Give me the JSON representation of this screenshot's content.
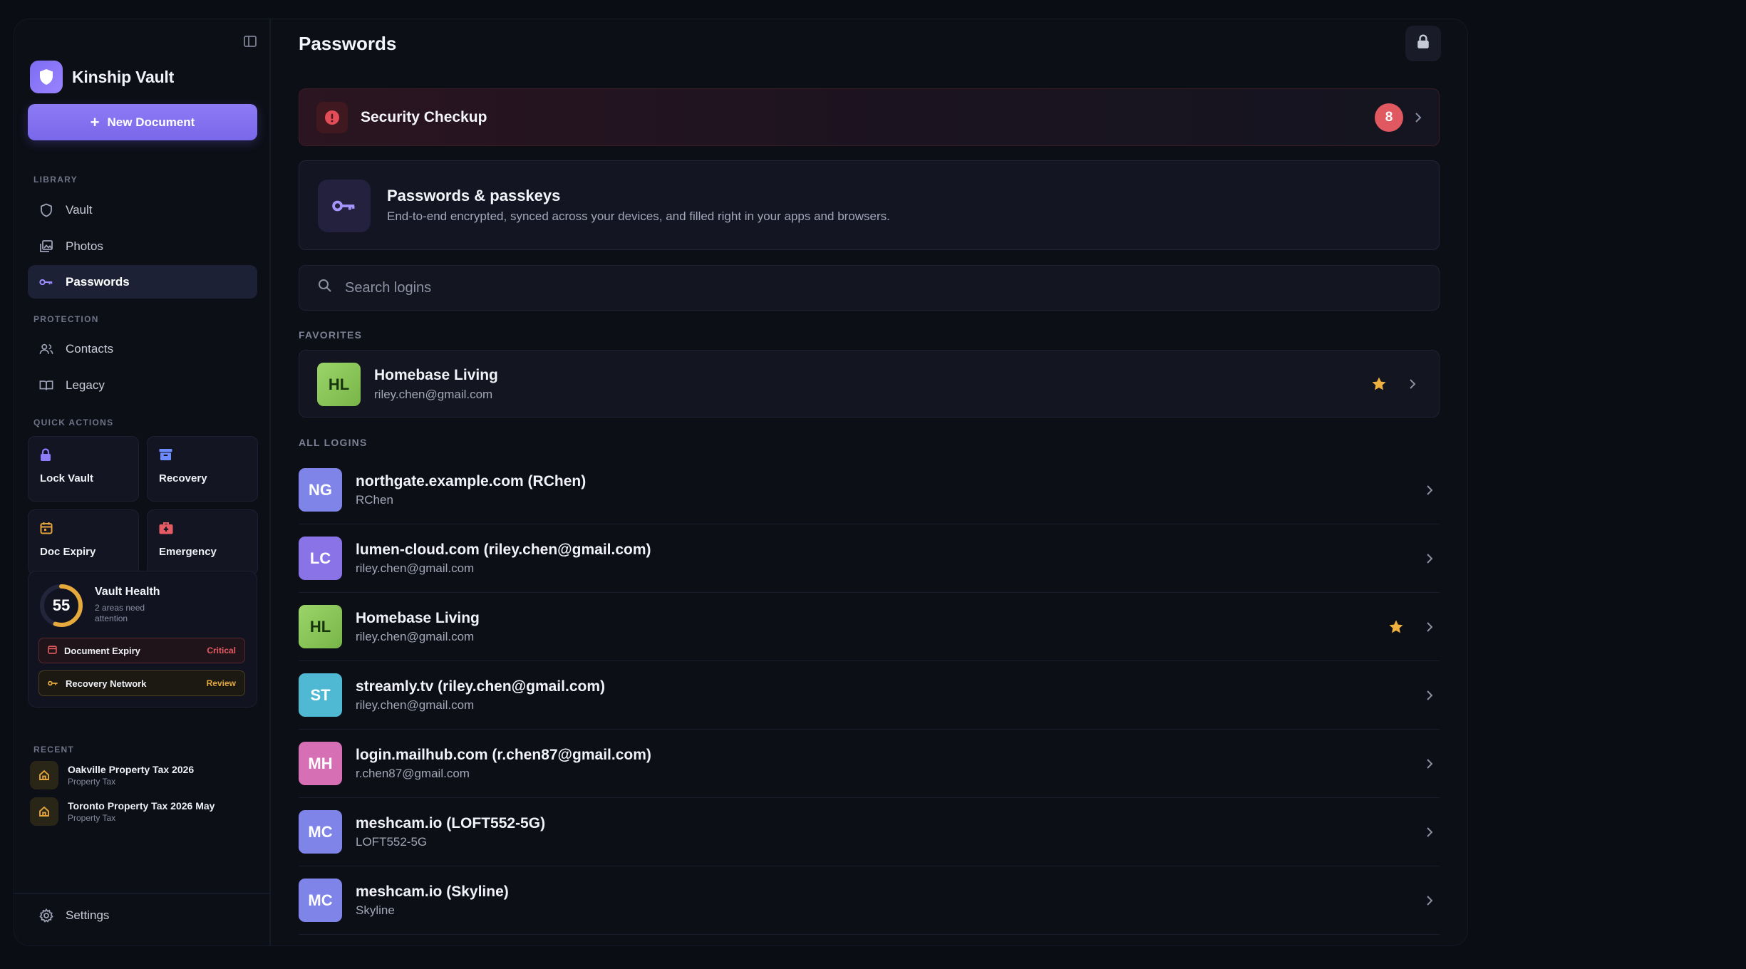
{
  "app": {
    "name": "Kinship Vault"
  },
  "sidebar": {
    "new_document_label": "New Document",
    "library_label": "LIBRARY",
    "library_items": [
      {
        "label": "Vault",
        "icon": "shield-icon"
      },
      {
        "label": "Photos",
        "icon": "photos-icon"
      },
      {
        "label": "Passwords",
        "icon": "key-icon",
        "active": true
      }
    ],
    "protection_label": "PROTECTION",
    "protection_items": [
      {
        "label": "Contacts",
        "icon": "contacts-icon"
      },
      {
        "label": "Legacy",
        "icon": "book-icon"
      }
    ],
    "quick_actions_label": "QUICK ACTIONS",
    "quick_actions": [
      {
        "label": "Lock Vault",
        "icon": "lock-icon",
        "color": "#8f7dff"
      },
      {
        "label": "Recovery",
        "icon": "archive-icon",
        "color": "#6f8cff"
      },
      {
        "label": "Doc Expiry",
        "icon": "calendar-icon",
        "color": "#e3a43c"
      },
      {
        "label": "Emergency",
        "icon": "medkit-icon",
        "color": "#e45b63"
      }
    ],
    "vault_health": {
      "score": "55",
      "score_value": 55,
      "title": "Vault Health",
      "subtitle": "2 areas need attention",
      "items": [
        {
          "label": "Document Expiry",
          "status": "Critical",
          "status_color": "#e65a62"
        },
        {
          "label": "Recovery Network",
          "status": "Review",
          "status_color": "#e2a83c"
        }
      ]
    },
    "recent_label": "RECENT",
    "recent": [
      {
        "title": "Oakville Property Tax 2026",
        "subtitle": "Property Tax"
      },
      {
        "title": "Toronto Property Tax 2026 May",
        "subtitle": "Property Tax"
      }
    ],
    "settings_label": "Settings"
  },
  "main": {
    "title": "Passwords",
    "security_checkup": {
      "label": "Security Checkup",
      "count": "8"
    },
    "info": {
      "title": "Passwords & passkeys",
      "description": "End-to-end encrypted, synced across your devices, and filled right in your apps and browsers."
    },
    "search_placeholder": "Search logins",
    "favorites_label": "FAVORITES",
    "favorites": [
      {
        "initials": "HL",
        "title": "Homebase Living",
        "subtitle": "riley.chen@gmail.com",
        "starred": true,
        "color": "#8cc85a"
      }
    ],
    "all_logins_label": "ALL LOGINS",
    "logins": [
      {
        "initials": "NG",
        "title": "northgate.example.com (RChen)",
        "subtitle": "RChen",
        "starred": false,
        "color": "#7f84e8"
      },
      {
        "initials": "LC",
        "title": "lumen-cloud.com (riley.chen@gmail.com)",
        "subtitle": "riley.chen@gmail.com",
        "starred": false,
        "color": "#8a73e6"
      },
      {
        "initials": "HL",
        "title": "Homebase Living",
        "subtitle": "riley.chen@gmail.com",
        "starred": true,
        "color": "#8cc85a"
      },
      {
        "initials": "ST",
        "title": "streamly.tv (riley.chen@gmail.com)",
        "subtitle": "riley.chen@gmail.com",
        "starred": false,
        "color": "#4fb9d3"
      },
      {
        "initials": "MH",
        "title": "login.mailhub.com (r.chen87@gmail.com)",
        "subtitle": "r.chen87@gmail.com",
        "starred": false,
        "color": "#d66fb3"
      },
      {
        "initials": "MC",
        "title": "meshcam.io (LOFT552-5G)",
        "subtitle": "LOFT552-5G",
        "starred": false,
        "color": "#7f84e8"
      },
      {
        "initials": "MC",
        "title": "meshcam.io (Skyline)",
        "subtitle": "Skyline",
        "starred": false,
        "color": "#7f84e8"
      }
    ]
  }
}
